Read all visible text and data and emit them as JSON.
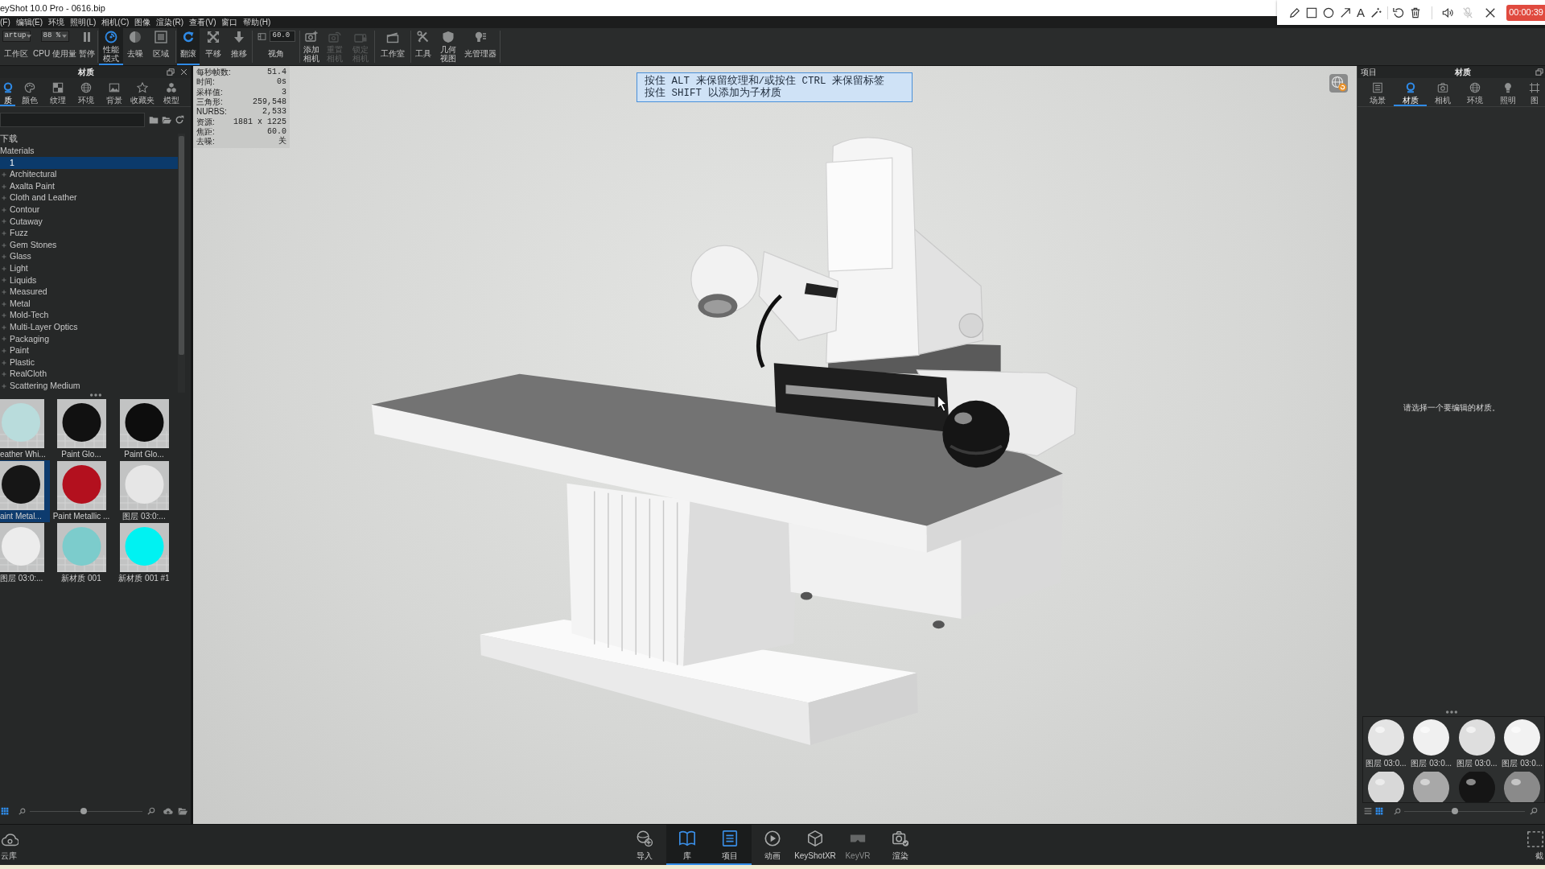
{
  "title_bar": {
    "title": "eyShot 10.0 Pro - 0616.bip"
  },
  "recorder": {
    "text_tool": "A",
    "mic_disabled": true,
    "timer": "00:00:39"
  },
  "menu_bar": [
    "(F)",
    "编辑(E)",
    "环境",
    "照明(L)",
    "相机(C)",
    "图像",
    "渲染(R)",
    "查看(V)",
    "窗口",
    "帮助(H)"
  ],
  "toolbar": {
    "groups": [
      [
        {
          "kind": "dropdown",
          "value": "artup",
          "label": "工作区"
        },
        {
          "kind": "dropdown",
          "value": "88 %",
          "label": "CPU 使用量"
        },
        {
          "kind": "button",
          "label": "暂停",
          "selected": false,
          "disabled": false
        }
      ],
      [
        {
          "kind": "button",
          "label": "性能模式",
          "selected": true,
          "disabled": false
        },
        {
          "kind": "button",
          "label": "去噪",
          "selected": false,
          "disabled": false
        },
        {
          "kind": "button",
          "label": "区域",
          "selected": false,
          "disabled": false
        }
      ],
      [
        {
          "kind": "button",
          "label": "翻滚",
          "selected": true,
          "disabled": false
        },
        {
          "kind": "button",
          "label": "平移",
          "selected": false,
          "disabled": false
        },
        {
          "kind": "button",
          "label": "推移",
          "selected": false,
          "disabled": false
        }
      ],
      [
        {
          "kind": "field",
          "value": "60.0",
          "label": "视角"
        }
      ],
      [
        {
          "kind": "button",
          "label": "添加相机",
          "selected": false,
          "disabled": false
        },
        {
          "kind": "button",
          "label": "重置相机",
          "selected": false,
          "disabled": true
        },
        {
          "kind": "button",
          "label": "锁定相机",
          "selected": false,
          "disabled": true
        }
      ],
      [
        {
          "kind": "button",
          "label": "工作室",
          "selected": false,
          "disabled": false
        }
      ],
      [
        {
          "kind": "button",
          "label": "工具",
          "selected": false,
          "disabled": false
        },
        {
          "kind": "button",
          "label": "几何视图",
          "selected": false,
          "disabled": false
        },
        {
          "kind": "button",
          "label": "光管理器",
          "selected": false,
          "disabled": false
        }
      ]
    ]
  },
  "library_panel": {
    "title": "材质",
    "tabs": [
      {
        "label": "质",
        "selected": true
      },
      {
        "label": "颜色",
        "selected": false
      },
      {
        "label": "纹理",
        "selected": false
      },
      {
        "label": "环境",
        "selected": false
      },
      {
        "label": "背景",
        "selected": false
      },
      {
        "label": "收藏夹",
        "selected": false
      },
      {
        "label": "模型",
        "selected": false
      }
    ],
    "tree": [
      {
        "label": "下载",
        "selected": false
      },
      {
        "label": "Materials",
        "selected": false,
        "children": [
          {
            "label": "1",
            "selected": true,
            "expandable": false
          },
          {
            "label": "Architectural",
            "selected": false,
            "expandable": true
          },
          {
            "label": "Axalta Paint",
            "selected": false,
            "expandable": true
          },
          {
            "label": "Cloth and Leather",
            "selected": false,
            "expandable": true
          },
          {
            "label": "Contour",
            "selected": false,
            "expandable": true
          },
          {
            "label": "Cutaway",
            "selected": false,
            "expandable": true
          },
          {
            "label": "Fuzz",
            "selected": false,
            "expandable": true
          },
          {
            "label": "Gem Stones",
            "selected": false,
            "expandable": true
          },
          {
            "label": "Glass",
            "selected": false,
            "expandable": true
          },
          {
            "label": "Light",
            "selected": false,
            "expandable": true
          },
          {
            "label": "Liquids",
            "selected": false,
            "expandable": true
          },
          {
            "label": "Measured",
            "selected": false,
            "expandable": true
          },
          {
            "label": "Metal",
            "selected": false,
            "expandable": true
          },
          {
            "label": "Mold-Tech",
            "selected": false,
            "expandable": true
          },
          {
            "label": "Multi-Layer Optics",
            "selected": false,
            "expandable": true
          },
          {
            "label": "Packaging",
            "selected": false,
            "expandable": true
          },
          {
            "label": "Paint",
            "selected": false,
            "expandable": true
          },
          {
            "label": "Plastic",
            "selected": false,
            "expandable": true
          },
          {
            "label": "RealCloth",
            "selected": false,
            "expandable": true
          },
          {
            "label": "Scattering Medium",
            "selected": false,
            "expandable": true
          }
        ]
      }
    ],
    "thumbnails": [
      {
        "label": "eather Whi...",
        "selected": false,
        "color": "#b9dcdc"
      },
      {
        "label": "Paint Glo...",
        "selected": false,
        "color": "#111111"
      },
      {
        "label": "Paint Glo...",
        "selected": false,
        "color": "#0d0d0d"
      },
      {
        "label": "aint Metal...",
        "selected": true,
        "color": "#161616"
      },
      {
        "label": "Paint Metallic ...",
        "selected": false,
        "color": "#b3101e"
      },
      {
        "label": "图层 03:0:...",
        "selected": false,
        "color": "#e6e6e6"
      },
      {
        "label": "图层 03:0:...",
        "selected": false,
        "color": "#ececec"
      },
      {
        "label": "新材质 001",
        "selected": false,
        "color": "#7ccccc"
      },
      {
        "label": "新材质 001 #1",
        "selected": false,
        "color": "#00f2f2"
      }
    ],
    "view_modes": [
      {
        "selected": true
      }
    ],
    "zoom_slider": {
      "level": 0.48
    }
  },
  "viewport": {
    "stats": [
      {
        "label": "每秒帧数:",
        "value": "51.4"
      },
      {
        "label": "时间:",
        "value": "0s"
      },
      {
        "label": "采样值:",
        "value": "3"
      },
      {
        "label": "三角形:",
        "value": "259,548"
      },
      {
        "label": "NURBS:",
        "value": "2,533"
      },
      {
        "label": "资源:",
        "value": "1881 x 1225"
      },
      {
        "label": "焦距:",
        "value": "60.0"
      },
      {
        "label": "去噪:",
        "value": "关"
      }
    ],
    "hint": [
      "按住 ALT 来保留纹理和/或按住 CTRL 来保留标签",
      "按住 SHIFT 以添加为子材质"
    ]
  },
  "project_panel": {
    "header": "项目",
    "title": "材质",
    "tabs": [
      {
        "label": "场景",
        "selected": false
      },
      {
        "label": "材质",
        "selected": true
      },
      {
        "label": "相机",
        "selected": false
      },
      {
        "label": "环境",
        "selected": false
      },
      {
        "label": "照明",
        "selected": false
      },
      {
        "label": "图",
        "selected": false
      }
    ],
    "message": "请选择一个要编辑的材质。",
    "thumbnails": [
      {
        "label": "图层 03:0...",
        "selected": false,
        "color": "#e4e4e4"
      },
      {
        "label": "图层 03:0...",
        "selected": false,
        "color": "#f0f0f0"
      },
      {
        "label": "图层 03:0...",
        "selected": false,
        "color": "#dedede"
      },
      {
        "label": "图层 03:0...",
        "selected": false,
        "color": "#f2f2f2"
      },
      {
        "selected": false,
        "color": "#d8d8d8"
      },
      {
        "selected": false,
        "color": "#a8a8a8"
      },
      {
        "selected": false,
        "color": "#151515"
      },
      {
        "selected": false,
        "color": "#8a8a8a"
      }
    ],
    "view_modes": [
      {
        "selected": false
      },
      {
        "selected": true
      }
    ],
    "zoom_slider": {
      "level": 0.42
    }
  },
  "dock": {
    "cloud": "云库",
    "buttons": [
      {
        "label": "导入",
        "selected": false,
        "disabled": false
      },
      {
        "label": "库",
        "selected": true,
        "disabled": false
      },
      {
        "label": "项目",
        "selected": true,
        "disabled": false
      },
      {
        "label": "动画",
        "selected": false,
        "disabled": false
      },
      {
        "label": "KeyShotXR",
        "selected": false,
        "disabled": false
      },
      {
        "label": "KeyVR",
        "selected": false,
        "disabled": true
      },
      {
        "label": "渲染",
        "selected": false,
        "disabled": false
      }
    ],
    "screenshot": "截"
  }
}
